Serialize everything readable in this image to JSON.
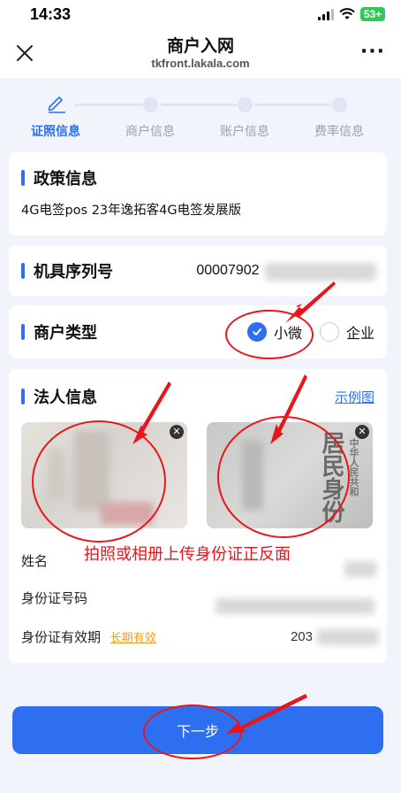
{
  "status_bar": {
    "time": "14:33",
    "battery": "53+"
  },
  "nav": {
    "title": "商户入网",
    "subtitle": "tkfront.lakala.com"
  },
  "steps": [
    {
      "label": "证照信息",
      "active": true
    },
    {
      "label": "商户信息",
      "active": false
    },
    {
      "label": "账户信息",
      "active": false
    },
    {
      "label": "费率信息",
      "active": false
    }
  ],
  "policy": {
    "title": "政策信息",
    "value": "4G电签pos 23年逸拓客4G电签发展版"
  },
  "serial": {
    "label": "机具序列号",
    "value": "00007902"
  },
  "merchant_type": {
    "label": "商户类型",
    "options": [
      "小微",
      "企业"
    ],
    "selected": "小微"
  },
  "legal": {
    "title": "法人信息",
    "example_link": "示例图",
    "id_back_text": "居民身份",
    "id_back_small": "中华人民共和",
    "name_label": "姓名",
    "id_number_label": "身份证号码",
    "id_validity_label": "身份证有效期",
    "long_term_link": "长期有效",
    "id_validity_value": "203"
  },
  "annotation": {
    "text": "拍照或相册上传身份证正反面"
  },
  "next_button": {
    "label": "下一步"
  },
  "colors": {
    "accent": "#2e6ff2",
    "annotation_red": "#e8161b",
    "warning": "#f0a020"
  }
}
